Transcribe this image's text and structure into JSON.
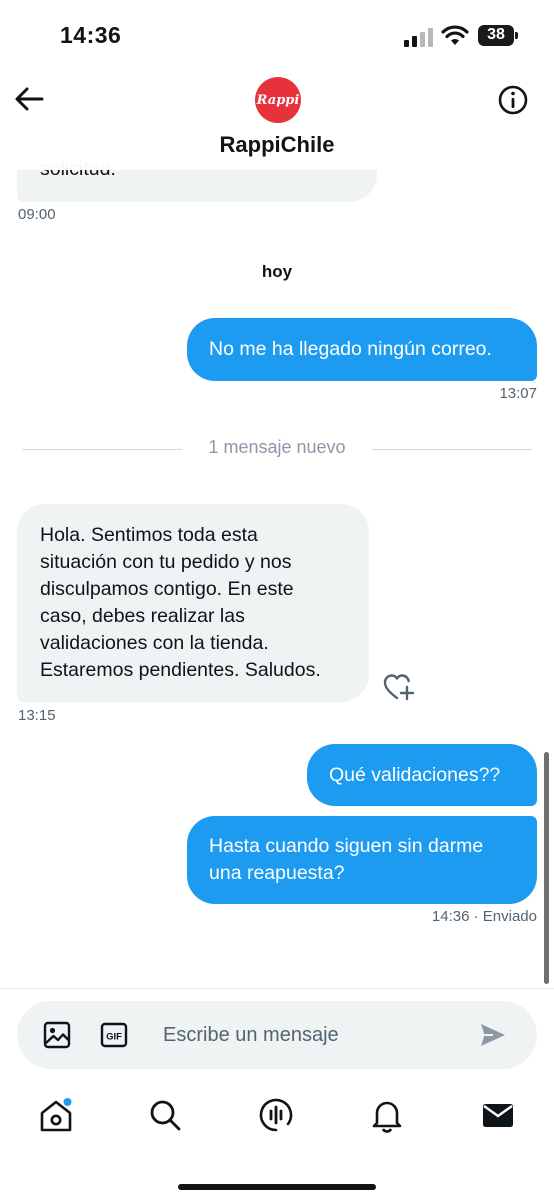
{
  "status_bar": {
    "time": "14:36",
    "battery": "38"
  },
  "header": {
    "title": "RappiChile",
    "logo_text": "Rappi"
  },
  "colors": {
    "accent": "#1d9bf0",
    "incoming_bg": "#eff3f4",
    "brand": "#e8323b"
  },
  "messages": {
    "partial": {
      "text": "solicitud.",
      "time": "09:00"
    },
    "day_separator": "hoy",
    "m1": {
      "text": "No me ha llegado ningún correo.",
      "time": "13:07"
    },
    "new_divider": "1 mensaje nuevo",
    "m2": {
      "text": "Hola. Sentimos toda esta\nsituación con tu pedido y nos\ndisculpamos contigo. En este\ncaso, debes realizar las\nvalidaciones con la tienda.\nEstaremos pendientes. Saludos.",
      "time": "13:15"
    },
    "m3": {
      "text": "Qué validaciones??"
    },
    "m4": {
      "text": "Hasta cuando siguen sin darme\nuna reapuesta?",
      "time": "14:36 · Enviado"
    }
  },
  "composer": {
    "placeholder": "Escribe un mensaje"
  },
  "icons": {
    "back": "arrow-left-icon",
    "info": "info-icon",
    "heart": "heart-plus-icon",
    "image": "image-icon",
    "gif": "gif-icon",
    "send": "send-icon",
    "home": "home-icon",
    "search": "search-icon",
    "spaces": "spaces-icon",
    "notifications": "bell-icon",
    "messages": "envelope-icon"
  }
}
